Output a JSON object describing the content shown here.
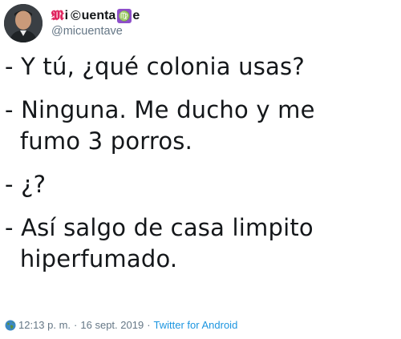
{
  "author": {
    "display_name_part1": "i ",
    "display_name_part2": "uenta ",
    "display_name_part3": "e",
    "m_glyph": "𝕸",
    "c_glyph": "©",
    "virgo_glyph": "♍",
    "handle": "@micuentave"
  },
  "tweet": {
    "lines": [
      "- Y tú, ¿qué colonia usas?",
      "- Ninguna. Me ducho y me",
      "  fumo 3 porros.",
      "- ¿?",
      "- Así salgo de casa limpito",
      "  hiperfumado."
    ]
  },
  "meta": {
    "time": "12:13 p. m.",
    "separator1": "·",
    "date": "16 sept. 2019",
    "separator2": "·",
    "source": "Twitter for Android"
  },
  "colors": {
    "text": "#14171a",
    "secondary": "#657786",
    "link": "#1b95e0",
    "m_glyph": "#e0245e",
    "virgo_badge": "#8e4fc9"
  },
  "icons": {
    "avatar": "profile-photo",
    "globe": "globe-icon"
  }
}
